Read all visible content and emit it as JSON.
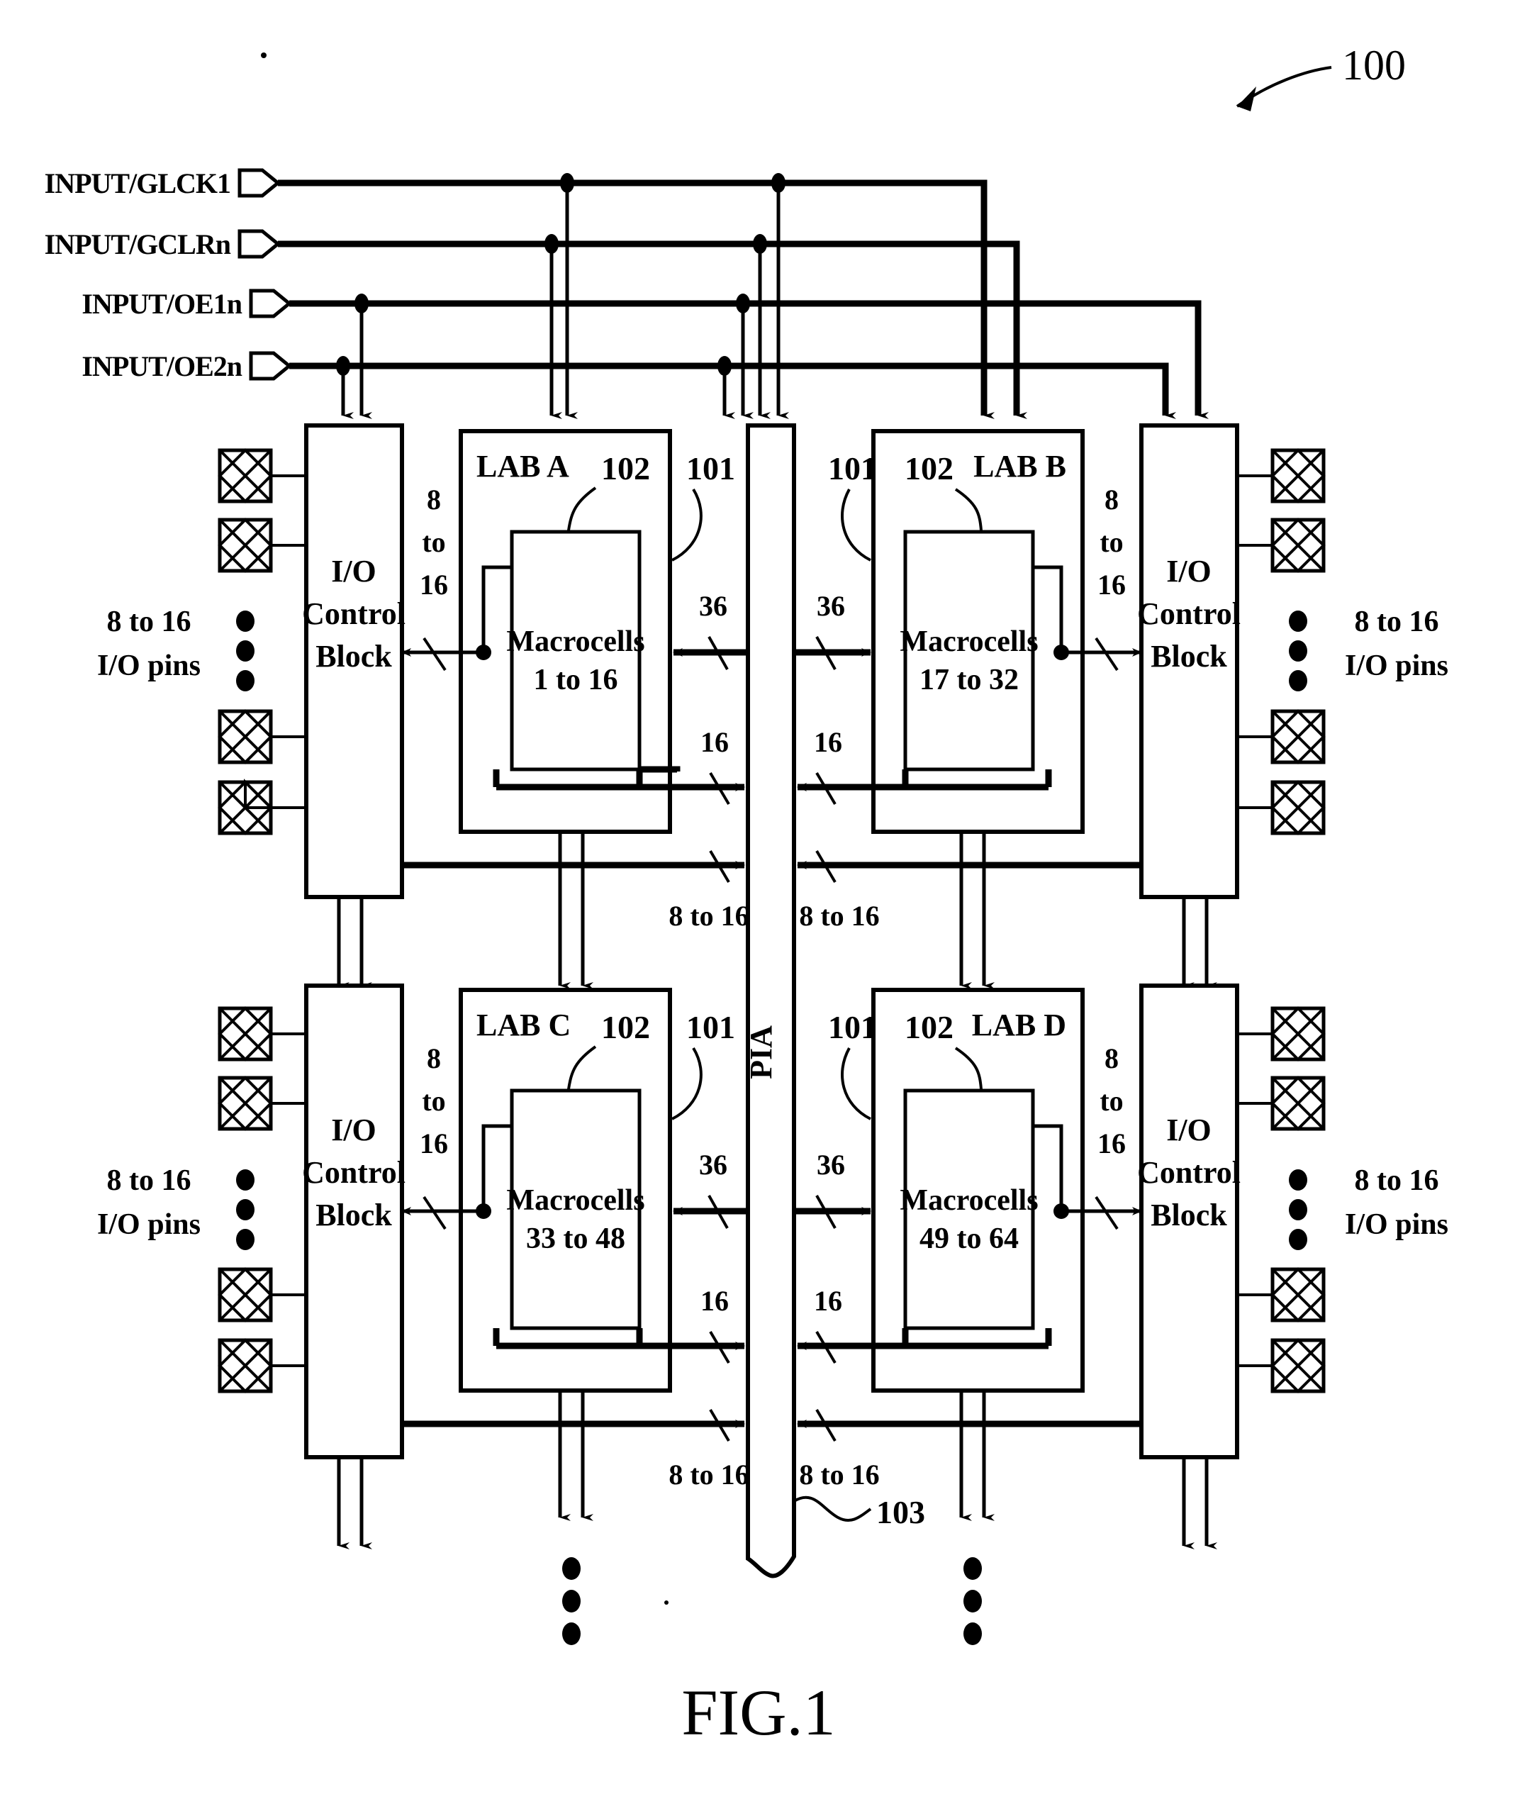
{
  "figure": {
    "caption": "FIG.1",
    "device_ref": "100",
    "pia_ref": "103",
    "pia_label": "PIA",
    "lab_ref": "101",
    "macrocell_ref": "102"
  },
  "inputs": [
    {
      "label": "INPUT/GLCK1"
    },
    {
      "label": "INPUT/GCLRn"
    },
    {
      "label": "INPUT/OE1n"
    },
    {
      "label": "INPUT/OE2n"
    }
  ],
  "io_control_block": {
    "label_line1": "I/O",
    "label_line2": "Control",
    "label_line3": "Block"
  },
  "io_pins": {
    "count_line1": "8 to 16",
    "count_line2": "I/O pins"
  },
  "labs": [
    {
      "name": "LAB A",
      "macrocells_line1": "Macrocells",
      "macrocells_line2": "1 to 16",
      "lab_ref": "101",
      "mac_ref": "102"
    },
    {
      "name": "LAB B",
      "macrocells_line1": "Macrocells",
      "macrocells_line2": "17 to 32",
      "lab_ref": "101",
      "mac_ref": "102"
    },
    {
      "name": "LAB C",
      "macrocells_line1": "Macrocells",
      "macrocells_line2": "33 to 48",
      "lab_ref": "101",
      "mac_ref": "102"
    },
    {
      "name": "LAB D",
      "macrocells_line1": "Macrocells",
      "macrocells_line2": "49 to 64",
      "lab_ref": "101",
      "mac_ref": "102"
    }
  ],
  "bus_widths": {
    "lab_to_io_l1": "8",
    "lab_to_io_l2": "to",
    "lab_to_io_l3": "16",
    "pia_to_lab": "36",
    "lab_to_pia": "16",
    "io_to_pia": "8 to 16"
  },
  "chart_data": {
    "type": "table",
    "title": "FIG.1 Complex Programmable Logic Device block diagram",
    "nodes": [
      {
        "id": "LAB A",
        "macrocells": "1 to 16",
        "quadrant": "top-left"
      },
      {
        "id": "LAB B",
        "macrocells": "17 to 32",
        "quadrant": "top-right"
      },
      {
        "id": "LAB C",
        "macrocells": "33 to 48",
        "quadrant": "bottom-left"
      },
      {
        "id": "LAB D",
        "macrocells": "49 to 64",
        "quadrant": "bottom-right"
      },
      {
        "id": "PIA",
        "ref": "103",
        "position": "center-column"
      }
    ],
    "edges": [
      {
        "from": "PIA",
        "to": "LAB A",
        "width": "36"
      },
      {
        "from": "LAB A",
        "to": "PIA",
        "width": "16"
      },
      {
        "from": "PIA",
        "to": "LAB B",
        "width": "36"
      },
      {
        "from": "LAB B",
        "to": "PIA",
        "width": "16"
      },
      {
        "from": "PIA",
        "to": "LAB C",
        "width": "36"
      },
      {
        "from": "LAB C",
        "to": "PIA",
        "width": "16"
      },
      {
        "from": "PIA",
        "to": "LAB D",
        "width": "36"
      },
      {
        "from": "LAB D",
        "to": "PIA",
        "width": "16"
      },
      {
        "from": "LAB A",
        "to": "I/O Control Block (left-top)",
        "width": "8 to 16"
      },
      {
        "from": "LAB B",
        "to": "I/O Control Block (right-top)",
        "width": "8 to 16"
      },
      {
        "from": "LAB C",
        "to": "I/O Control Block (left-bottom)",
        "width": "8 to 16"
      },
      {
        "from": "LAB D",
        "to": "I/O Control Block (right-bottom)",
        "width": "8 to 16"
      },
      {
        "from": "I/O Control Block (left-top)",
        "to": "PIA",
        "width": "8 to 16"
      },
      {
        "from": "I/O Control Block (right-top)",
        "to": "PIA",
        "width": "8 to 16"
      },
      {
        "from": "I/O Control Block (left-bottom)",
        "to": "PIA",
        "width": "8 to 16"
      },
      {
        "from": "I/O Control Block (right-bottom)",
        "to": "PIA",
        "width": "8 to 16"
      }
    ],
    "global_inputs": [
      "INPUT/GLCK1",
      "INPUT/GCLRn",
      "INPUT/OE1n",
      "INPUT/OE2n"
    ]
  }
}
